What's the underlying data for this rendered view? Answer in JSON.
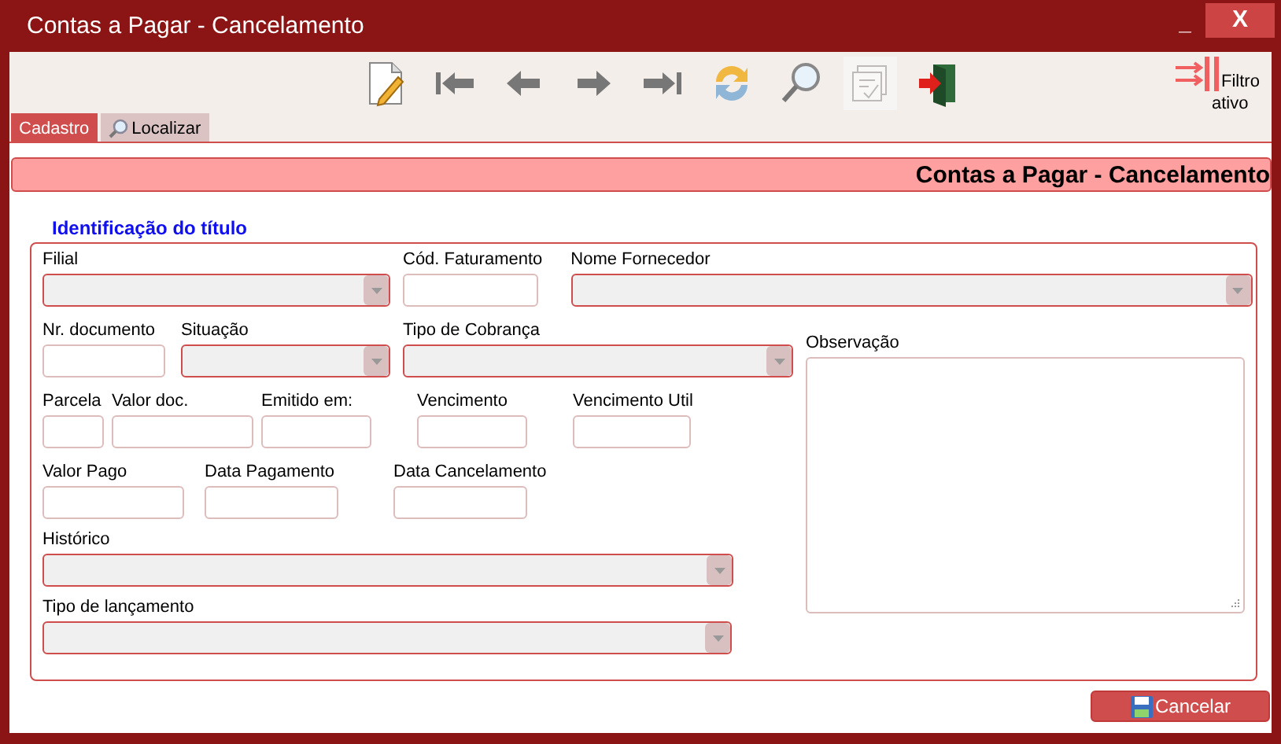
{
  "window": {
    "title": "Contas a Pagar - Cancelamento",
    "controls": [
      "_",
      "X"
    ]
  },
  "toolbar": [
    {
      "kind": "new",
      "disabled": false
    },
    {
      "kind": "first",
      "disabled": false
    },
    {
      "kind": "prev",
      "disabled": false
    },
    {
      "kind": "next",
      "disabled": false
    },
    {
      "kind": "last",
      "disabled": false
    },
    {
      "kind": "refresh",
      "disabled": false
    },
    {
      "kind": "search",
      "disabled": false
    },
    {
      "kind": "checklist",
      "disabled": true
    },
    {
      "kind": "exit",
      "disabled": false
    }
  ],
  "filter": {
    "label": "Filtro ativo"
  },
  "tabs": [
    {
      "label": "Cadastro",
      "selected": true,
      "icon": false
    },
    {
      "label": "Localizar",
      "selected": false,
      "icon": true
    }
  ],
  "header": {
    "title": "Contas a Pagar - Cancelamento"
  },
  "section": {
    "title": "Identificação do título"
  },
  "rows": [
    [
      {
        "label": "Filial",
        "kind": "select"
      },
      {
        "label": "Cód. Faturamento",
        "kind": "input"
      },
      {
        "label": "Nome Fornecedor",
        "kind": "select"
      }
    ],
    [
      {
        "label": "Nr. documento",
        "kind": "input"
      },
      {
        "label": "Situação",
        "kind": "select"
      },
      {
        "label": "Tipo de Cobrança",
        "kind": "select"
      }
    ],
    [
      {
        "label": "Parcela",
        "kind": "input"
      },
      {
        "label": "Valor doc.",
        "kind": "input"
      },
      {
        "label": "Emitido em:",
        "kind": "input"
      },
      {
        "label": "Vencimento",
        "kind": "input"
      },
      {
        "label": "Vencimento Util",
        "kind": "input"
      }
    ],
    [
      {
        "label": "Valor Pago",
        "kind": "input"
      },
      {
        "label": "Data Pagamento",
        "kind": "input"
      },
      {
        "label": "Data Cancelamento",
        "kind": "input"
      }
    ],
    [
      {
        "label": "Histórico",
        "kind": "select"
      }
    ],
    [
      {
        "label": "Tipo de lançamento",
        "kind": "select"
      }
    ]
  ],
  "observation": {
    "label": "Observação"
  },
  "cancel_button": {
    "label": "Cancelar"
  }
}
